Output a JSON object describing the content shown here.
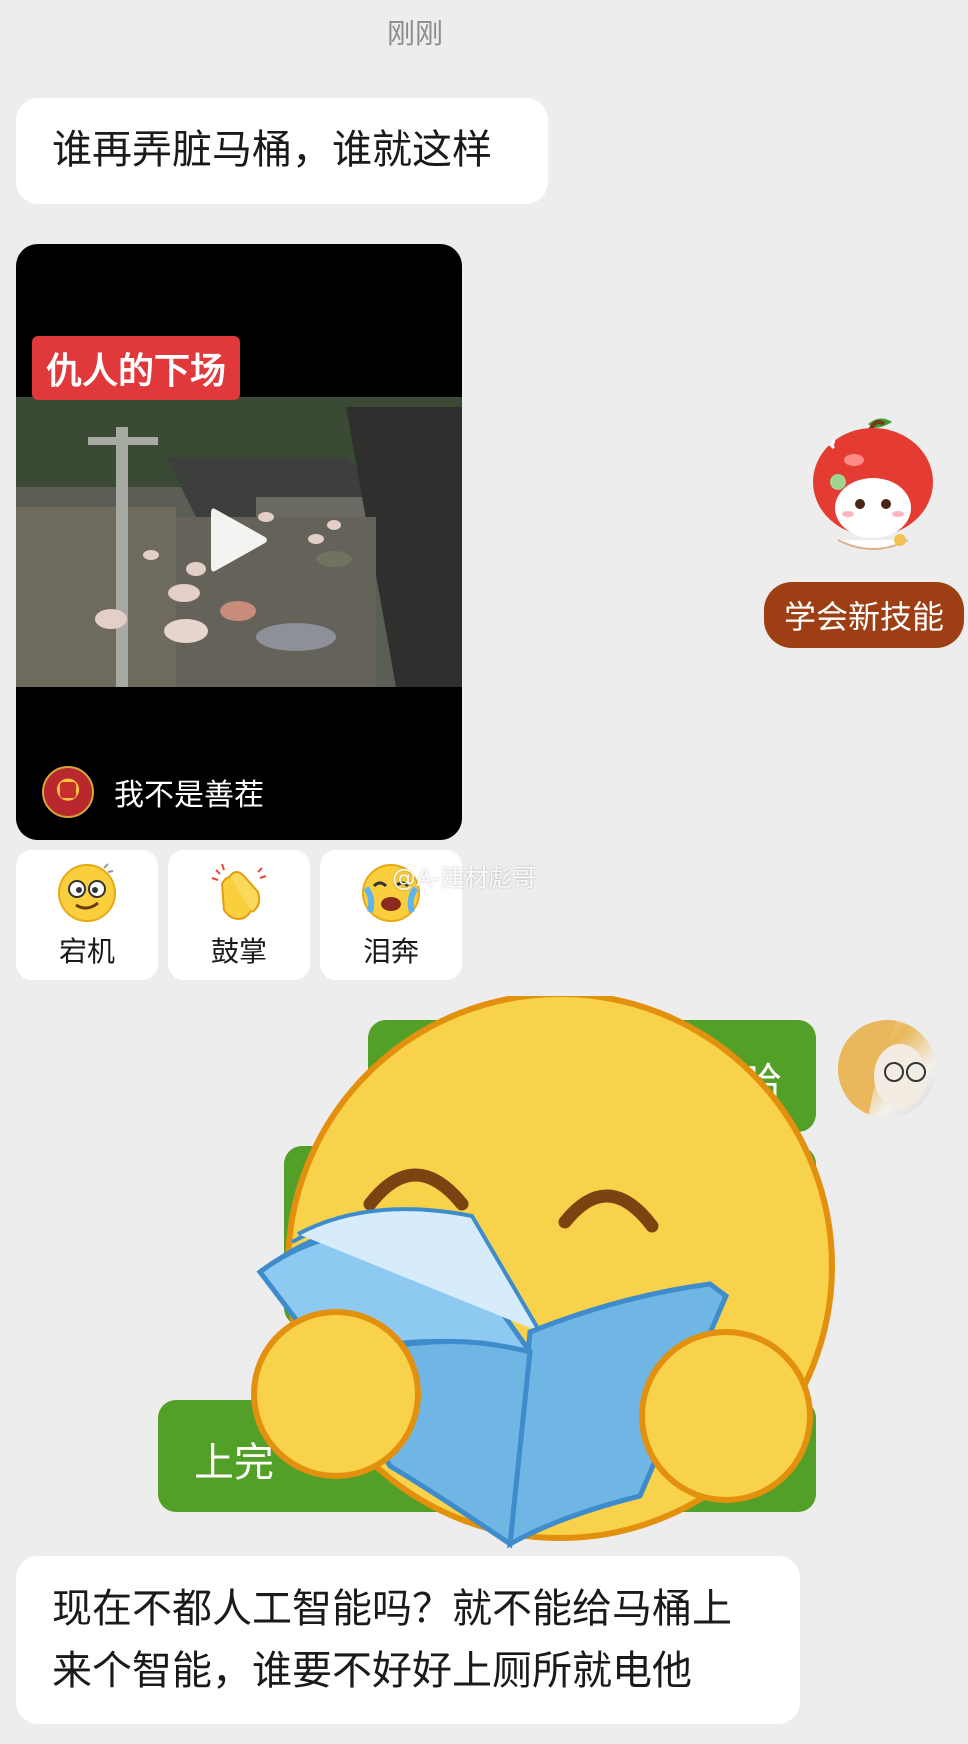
{
  "header": {
    "timestamp": "刚刚"
  },
  "messages": {
    "msg1": "谁再弄脏马桶，谁就这样",
    "video": {
      "title": "仇人的下场",
      "author": "我不是善茬",
      "play_icon": "play-icon"
    },
    "last": "现在不都人工智能吗？就不能给马桶上来个智能，谁要不好好上厕所就电他"
  },
  "reactions": [
    {
      "icon": "dizzy-face-icon",
      "label": "宕机"
    },
    {
      "icon": "clapping-hands-icon",
      "label": "鼓掌"
    },
    {
      "icon": "crying-face-icon",
      "label": "泪奔"
    }
  ],
  "watermark": "@A-建材彪哥",
  "side_widget": {
    "label": "学会新技能",
    "icon": "apple-mascot-icon"
  },
  "sent": {
    "bubble1_visible_text": "哈",
    "bubble3_visible_text": "上完"
  },
  "overlay": {
    "icon": "reading-book-emoji-icon"
  },
  "colors": {
    "background": "#ededed",
    "sent_bubble": "#53a028",
    "received_bubble": "#ffffff",
    "video_title_bg": "#e0383b",
    "skill_pill_bg": "#9d3e14"
  }
}
